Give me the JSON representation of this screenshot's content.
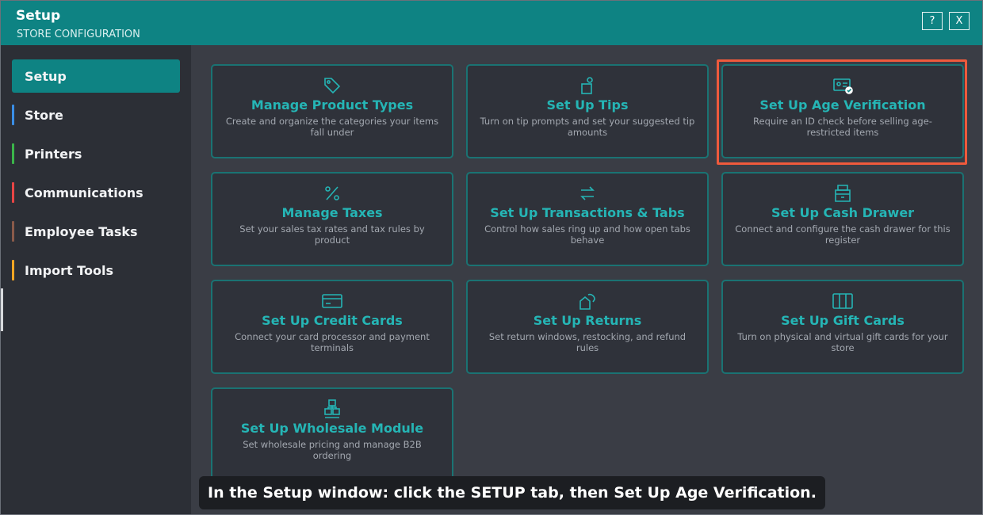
{
  "window": {
    "title": "Setup",
    "subtitle": "STORE CONFIGURATION",
    "help_label": "?",
    "close_label": "X"
  },
  "sidebar": {
    "items": [
      {
        "label": "Setup",
        "active": true,
        "color": "#0e8383"
      },
      {
        "label": "Store",
        "active": false,
        "color": "#3a8ee6"
      },
      {
        "label": "Printers",
        "active": false,
        "color": "#3bb54a"
      },
      {
        "label": "Communications",
        "active": false,
        "color": "#e84545"
      },
      {
        "label": "Employee Tasks",
        "active": false,
        "color": "#8a5a4a"
      },
      {
        "label": "Import Tools",
        "active": false,
        "color": "#f5a623"
      }
    ]
  },
  "cards": [
    {
      "icon": "tag-icon",
      "title": "Manage Product Types",
      "desc": "Create and organize the categories your items fall under"
    },
    {
      "icon": "tip-jar-icon",
      "title": "Set Up Tips",
      "desc": "Turn on tip prompts and set your suggested tip amounts"
    },
    {
      "icon": "id-card-check-icon",
      "title": "Set Up Age Verification",
      "desc": "Require an ID check before selling age-restricted items",
      "highlighted": true
    },
    {
      "icon": "percent-icon",
      "title": "Manage Taxes",
      "desc": "Set your sales tax rates and tax rules by product"
    },
    {
      "icon": "swap-arrows-icon",
      "title": "Set Up Transactions & Tabs",
      "desc": "Control how sales ring up and how open tabs behave"
    },
    {
      "icon": "cash-drawer-icon",
      "title": "Set Up Cash Drawer",
      "desc": "Connect and configure the cash drawer for this register"
    },
    {
      "icon": "credit-card-icon",
      "title": "Set Up Credit Cards",
      "desc": "Connect your card processor and payment terminals"
    },
    {
      "icon": "return-icon",
      "title": "Set Up Returns",
      "desc": "Set return windows, restocking, and refund rules"
    },
    {
      "icon": "gift-card-icon",
      "title": "Set Up Gift Cards",
      "desc": "Turn on physical and virtual gift cards for your store"
    },
    {
      "icon": "boxes-icon",
      "title": "Set Up Wholesale Module",
      "desc": "Set wholesale pricing and manage B2B ordering"
    }
  ],
  "caption": "In the Setup window: click the SETUP tab, then Set Up Age Verification.",
  "colors": {
    "accent": "#0e8383",
    "card_title": "#25b5b5",
    "highlight": "#ef5a3c"
  }
}
